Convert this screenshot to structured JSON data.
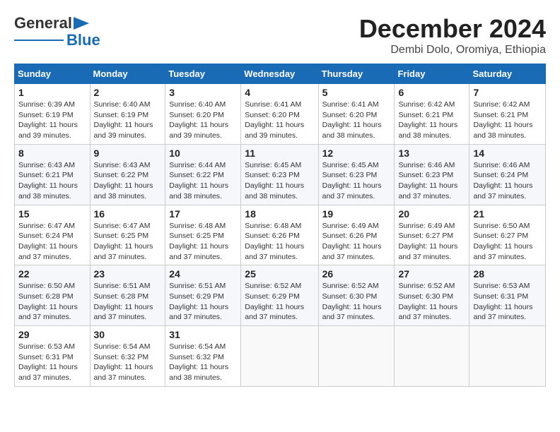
{
  "logo": {
    "line1": "General",
    "line2": "Blue"
  },
  "header": {
    "month": "December 2024",
    "location": "Dembi Dolo, Oromiya, Ethiopia"
  },
  "weekdays": [
    "Sunday",
    "Monday",
    "Tuesday",
    "Wednesday",
    "Thursday",
    "Friday",
    "Saturday"
  ],
  "weeks": [
    [
      {
        "day": "1",
        "info": "Sunrise: 6:39 AM\nSunset: 6:19 PM\nDaylight: 11 hours\nand 39 minutes."
      },
      {
        "day": "2",
        "info": "Sunrise: 6:40 AM\nSunset: 6:19 PM\nDaylight: 11 hours\nand 39 minutes."
      },
      {
        "day": "3",
        "info": "Sunrise: 6:40 AM\nSunset: 6:20 PM\nDaylight: 11 hours\nand 39 minutes."
      },
      {
        "day": "4",
        "info": "Sunrise: 6:41 AM\nSunset: 6:20 PM\nDaylight: 11 hours\nand 39 minutes."
      },
      {
        "day": "5",
        "info": "Sunrise: 6:41 AM\nSunset: 6:20 PM\nDaylight: 11 hours\nand 38 minutes."
      },
      {
        "day": "6",
        "info": "Sunrise: 6:42 AM\nSunset: 6:21 PM\nDaylight: 11 hours\nand 38 minutes."
      },
      {
        "day": "7",
        "info": "Sunrise: 6:42 AM\nSunset: 6:21 PM\nDaylight: 11 hours\nand 38 minutes."
      }
    ],
    [
      {
        "day": "8",
        "info": "Sunrise: 6:43 AM\nSunset: 6:21 PM\nDaylight: 11 hours\nand 38 minutes."
      },
      {
        "day": "9",
        "info": "Sunrise: 6:43 AM\nSunset: 6:22 PM\nDaylight: 11 hours\nand 38 minutes."
      },
      {
        "day": "10",
        "info": "Sunrise: 6:44 AM\nSunset: 6:22 PM\nDaylight: 11 hours\nand 38 minutes."
      },
      {
        "day": "11",
        "info": "Sunrise: 6:45 AM\nSunset: 6:23 PM\nDaylight: 11 hours\nand 38 minutes."
      },
      {
        "day": "12",
        "info": "Sunrise: 6:45 AM\nSunset: 6:23 PM\nDaylight: 11 hours\nand 37 minutes."
      },
      {
        "day": "13",
        "info": "Sunrise: 6:46 AM\nSunset: 6:23 PM\nDaylight: 11 hours\nand 37 minutes."
      },
      {
        "day": "14",
        "info": "Sunrise: 6:46 AM\nSunset: 6:24 PM\nDaylight: 11 hours\nand 37 minutes."
      }
    ],
    [
      {
        "day": "15",
        "info": "Sunrise: 6:47 AM\nSunset: 6:24 PM\nDaylight: 11 hours\nand 37 minutes."
      },
      {
        "day": "16",
        "info": "Sunrise: 6:47 AM\nSunset: 6:25 PM\nDaylight: 11 hours\nand 37 minutes."
      },
      {
        "day": "17",
        "info": "Sunrise: 6:48 AM\nSunset: 6:25 PM\nDaylight: 11 hours\nand 37 minutes."
      },
      {
        "day": "18",
        "info": "Sunrise: 6:48 AM\nSunset: 6:26 PM\nDaylight: 11 hours\nand 37 minutes."
      },
      {
        "day": "19",
        "info": "Sunrise: 6:49 AM\nSunset: 6:26 PM\nDaylight: 11 hours\nand 37 minutes."
      },
      {
        "day": "20",
        "info": "Sunrise: 6:49 AM\nSunset: 6:27 PM\nDaylight: 11 hours\nand 37 minutes."
      },
      {
        "day": "21",
        "info": "Sunrise: 6:50 AM\nSunset: 6:27 PM\nDaylight: 11 hours\nand 37 minutes."
      }
    ],
    [
      {
        "day": "22",
        "info": "Sunrise: 6:50 AM\nSunset: 6:28 PM\nDaylight: 11 hours\nand 37 minutes."
      },
      {
        "day": "23",
        "info": "Sunrise: 6:51 AM\nSunset: 6:28 PM\nDaylight: 11 hours\nand 37 minutes."
      },
      {
        "day": "24",
        "info": "Sunrise: 6:51 AM\nSunset: 6:29 PM\nDaylight: 11 hours\nand 37 minutes."
      },
      {
        "day": "25",
        "info": "Sunrise: 6:52 AM\nSunset: 6:29 PM\nDaylight: 11 hours\nand 37 minutes."
      },
      {
        "day": "26",
        "info": "Sunrise: 6:52 AM\nSunset: 6:30 PM\nDaylight: 11 hours\nand 37 minutes."
      },
      {
        "day": "27",
        "info": "Sunrise: 6:52 AM\nSunset: 6:30 PM\nDaylight: 11 hours\nand 37 minutes."
      },
      {
        "day": "28",
        "info": "Sunrise: 6:53 AM\nSunset: 6:31 PM\nDaylight: 11 hours\nand 37 minutes."
      }
    ],
    [
      {
        "day": "29",
        "info": "Sunrise: 6:53 AM\nSunset: 6:31 PM\nDaylight: 11 hours\nand 37 minutes."
      },
      {
        "day": "30",
        "info": "Sunrise: 6:54 AM\nSunset: 6:32 PM\nDaylight: 11 hours\nand 37 minutes."
      },
      {
        "day": "31",
        "info": "Sunrise: 6:54 AM\nSunset: 6:32 PM\nDaylight: 11 hours\nand 38 minutes."
      },
      null,
      null,
      null,
      null
    ]
  ]
}
